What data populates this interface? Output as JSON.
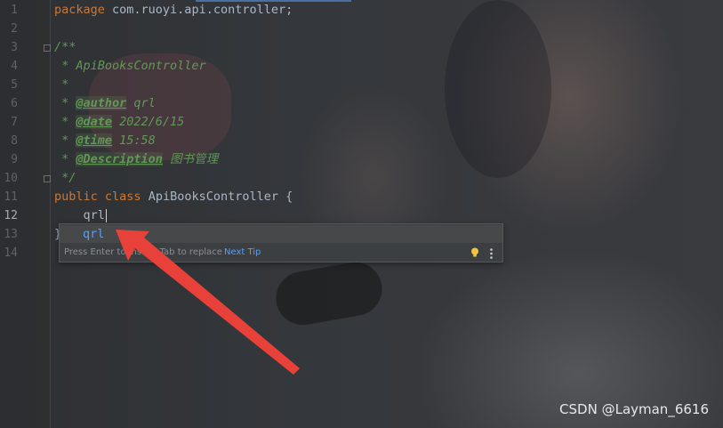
{
  "editor": {
    "line_numbers": [
      "1",
      "2",
      "3",
      "4",
      "5",
      "6",
      "7",
      "8",
      "9",
      "10",
      "11",
      "12",
      "13",
      "14"
    ],
    "active_line": "12",
    "lines": {
      "l1_kw": "package",
      "l1_rest": " com.ruoyi.api.controller;",
      "l3": "/**",
      "l4": " * ApiBooksController",
      "l5": " *",
      "l6_pre": " * ",
      "l6_tag": "@author",
      "l6_val": " qrl",
      "l7_pre": " * ",
      "l7_tag": "@date",
      "l7_val": " 2022/6/15",
      "l8_pre": " * ",
      "l8_tag": "@time",
      "l8_val": " 15:58",
      "l9_pre": " * ",
      "l9_tag": "@Description",
      "l9_val": " 图书管理",
      "l10": " */",
      "l11_kw1": "public",
      "l11_kw2": " class",
      "l11_rest": " ApiBooksController {",
      "l12": "    qrl",
      "l13": "}"
    }
  },
  "completion_popup": {
    "item": "qrl",
    "hint": "Press Enter to insert, Tab to replace",
    "next_tip": "Next Tip",
    "bulb_icon": "lightbulb-icon",
    "more_icon": "more-vertical-icon"
  },
  "watermark": "CSDN @Layman_6616",
  "colors": {
    "keyword": "#cc7832",
    "comment": "#629755",
    "identifier": "#a9b7c6",
    "completion": "#589df6",
    "arrow": "#e8413a"
  }
}
